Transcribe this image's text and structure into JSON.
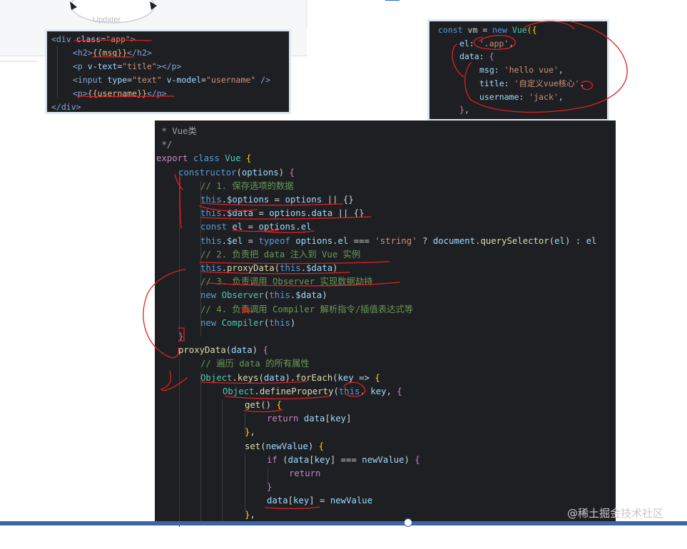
{
  "background": {
    "label": "Updater"
  },
  "template_panel": {
    "lines": [
      "<div class=\"app\">",
      "  <h2>{{msg}}</h2>",
      "  <p v-text=\"title\"></p>",
      "  <input type=\"text\" v-model=\"username\" />",
      "  <p>{{username}}</p>",
      "</div>"
    ]
  },
  "vm_panel": {
    "lines": [
      "const vm = new Vue({",
      "    el: '.app',",
      "    data: {",
      "        msg: 'hello vue',",
      "        title: '自定义vue核心',",
      "        username: 'jack',",
      "    },"
    ]
  },
  "main_code": {
    "lines": [
      " * Vue类",
      " */",
      "export class Vue {",
      "    constructor(options) {",
      "        // 1. 保存选项的数据",
      "        this.$options = options || {}",
      "        this.$data = options.data || {}",
      "        const el = options.el",
      "        this.$el = typeof options.el === 'string' ? document.querySelector(el) : el",
      "        // 2. 负责把 data 注入到 Vue 实例",
      "        this.proxyData(this.$data)",
      "        // 3. 负责调用 Observer 实现数据劫持",
      "        new Observer(this.$data)",
      "        // 4. 负责调用 Compiler 解析指令/插值表达式等",
      "        new Compiler(this)",
      "    }",
      "    proxyData(data) {",
      "        // 遍历 data 的所有属性",
      "        Object.keys(data).forEach(key => {",
      "            Object.defineProperty(this, key, {",
      "                get() {",
      "                    return data[key]",
      "                },",
      "                set(newValue) {",
      "                    if (data[key] === newValue) {",
      "                        return",
      "                    }",
      "                    data[key] = newValue",
      "                },"
    ]
  },
  "watermark": "@稀土掘金技术社区",
  "colors": {
    "editor_bg": "#1e1f23",
    "annotation_red": "#e02020",
    "comment": "#6a9955",
    "keyword": "#569cd6"
  }
}
